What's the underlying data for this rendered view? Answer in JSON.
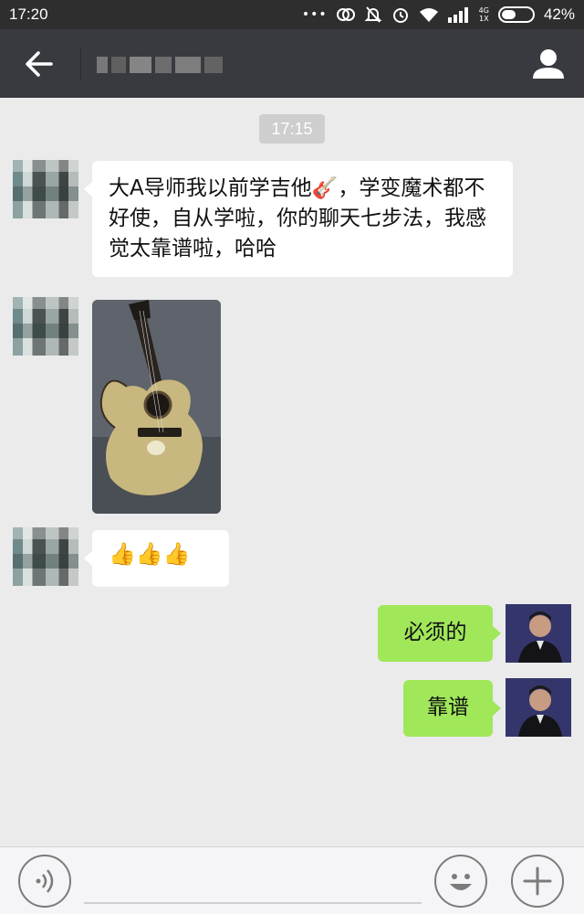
{
  "status_bar": {
    "time": "17:20",
    "network_top": "4G",
    "network_bottom": "1X",
    "battery_percent": "42%",
    "icons": [
      "more-dots-icon",
      "sync-icon",
      "mute-icon",
      "alarm-icon",
      "wifi-icon",
      "signal-icon",
      "battery-icon"
    ]
  },
  "header": {
    "title": "",
    "back_icon": "arrow-left-icon",
    "contact_icon": "person-icon"
  },
  "chat": {
    "timestamp": "17:15",
    "messages": [
      {
        "side": "left",
        "type": "text",
        "text": "大A导师我以前学吉他🎸，学变魔术都不好使，自从学啦，你的聊天七步法，我感觉太靠谱啦，哈哈"
      },
      {
        "side": "left",
        "type": "image",
        "image": "guitar-photo"
      },
      {
        "side": "left",
        "type": "text",
        "text": "👍👍👍"
      },
      {
        "side": "right",
        "type": "text",
        "text": "必须的"
      },
      {
        "side": "right",
        "type": "text",
        "text": "靠谱"
      }
    ]
  },
  "input_bar": {
    "voice_icon": "voice-icon",
    "input_value": "",
    "emoji_icon": "smiley-icon",
    "plus_icon": "plus-icon"
  },
  "colors": {
    "status_bar_bg": "#2e2e2e",
    "title_bar_bg": "#393a3f",
    "chat_bg": "#ebebeb",
    "sent_bubble": "#a0e75a",
    "received_bubble": "#ffffff"
  }
}
